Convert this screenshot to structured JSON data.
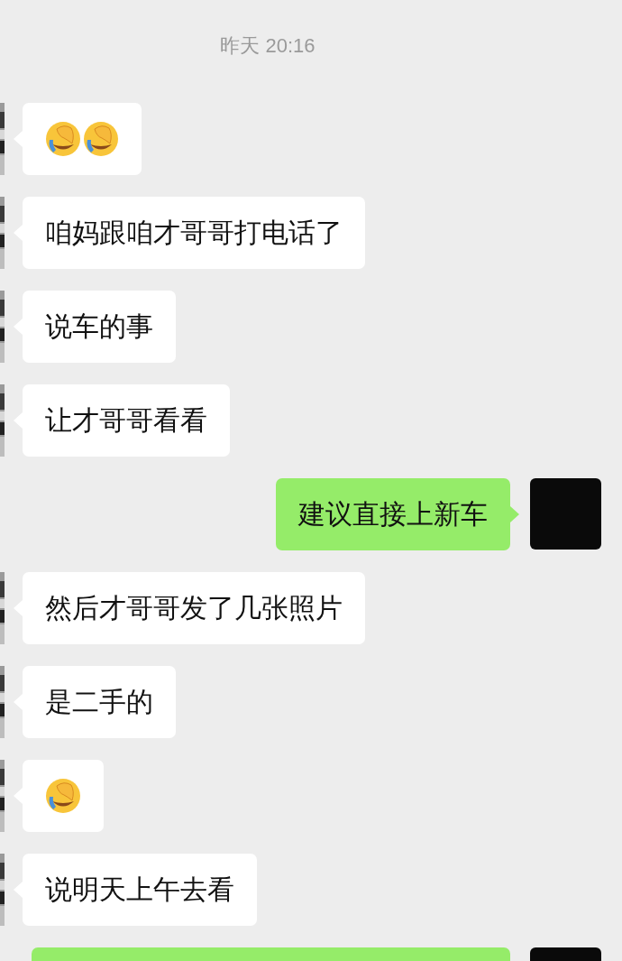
{
  "timestamp": "昨天 20:16",
  "messages": [
    {
      "kind": "received_emoji",
      "emojis": [
        {
          "kind": "facepalm"
        },
        {
          "kind": "facepalm"
        }
      ]
    },
    {
      "kind": "received_text",
      "text": "咱妈跟咱才哥哥打电话了"
    },
    {
      "kind": "received_text",
      "text": "说车的事"
    },
    {
      "kind": "received_text",
      "text": "让才哥哥看看"
    },
    {
      "kind": "sent_text",
      "text": "建议直接上新车"
    },
    {
      "kind": "received_text",
      "text": "然后才哥哥发了几张照片"
    },
    {
      "kind": "received_text",
      "text": "是二手的"
    },
    {
      "kind": "received_emoji",
      "emojis": [
        {
          "kind": "facepalm"
        }
      ]
    },
    {
      "kind": "received_text",
      "text": "说明天上午去看"
    },
    {
      "kind": "sent_text"
    }
  ]
}
